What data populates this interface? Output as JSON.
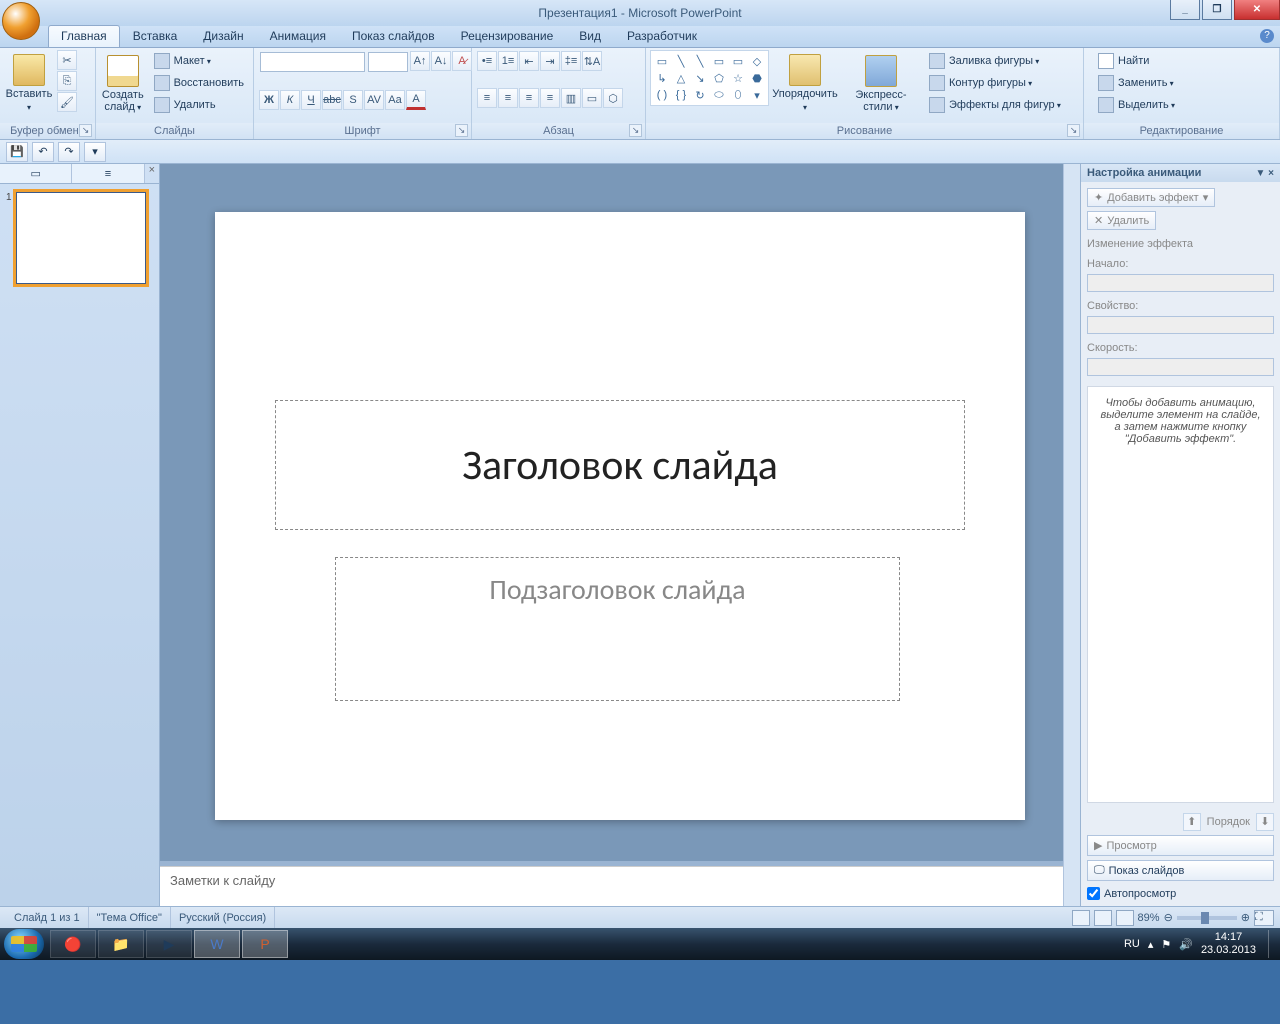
{
  "title": "Презентация1 - Microsoft PowerPoint",
  "tabs": [
    "Главная",
    "Вставка",
    "Дизайн",
    "Анимация",
    "Показ слайдов",
    "Рецензирование",
    "Вид",
    "Разработчик"
  ],
  "active_tab": 0,
  "ribbon": {
    "clipboard": {
      "label": "Буфер обмена",
      "paste": "Вставить"
    },
    "slides": {
      "label": "Слайды",
      "new": "Создать\nслайд",
      "layout": "Макет",
      "reset": "Восстановить",
      "delete": "Удалить"
    },
    "font": {
      "label": "Шрифт"
    },
    "paragraph": {
      "label": "Абзац"
    },
    "drawing": {
      "label": "Рисование",
      "arrange": "Упорядочить",
      "quick": "Экспресс-стили",
      "fill": "Заливка фигуры",
      "outline": "Контур фигуры",
      "effects": "Эффекты для фигур"
    },
    "editing": {
      "label": "Редактирование",
      "find": "Найти",
      "replace": "Заменить",
      "select": "Выделить"
    }
  },
  "slide": {
    "title_ph": "Заголовок слайда",
    "sub_ph": "Подзаголовок слайда"
  },
  "notes_ph": "Заметки к слайду",
  "anim": {
    "title": "Настройка анимации",
    "add_effect": "Добавить эффект",
    "remove": "Удалить",
    "change_label": "Изменение эффекта",
    "start_label": "Начало:",
    "prop_label": "Свойство:",
    "speed_label": "Скорость:",
    "hint": "Чтобы добавить анимацию, выделите элемент на слайде, а затем нажмите кнопку \"Добавить эффект\".",
    "order": "Порядок",
    "preview": "Просмотр",
    "slideshow": "Показ слайдов",
    "autopreview": "Автопросмотр"
  },
  "status": {
    "slide": "Слайд 1 из 1",
    "theme": "\"Тема Office\"",
    "lang": "Русский (Россия)",
    "zoom": "89%"
  },
  "tray": {
    "lang": "RU",
    "time": "14:17",
    "date": "23.03.2013"
  }
}
